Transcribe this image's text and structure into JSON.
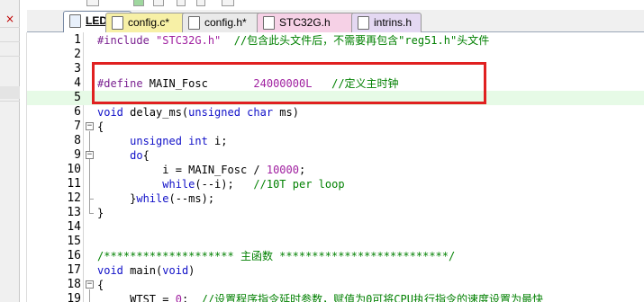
{
  "tabs": [
    {
      "label": "LED.c",
      "active": true,
      "color": "#ffffff"
    },
    {
      "label": "config.c*",
      "active": false,
      "color": "#f7f0a6"
    },
    {
      "label": "config.h*",
      "active": false,
      "color": "#eaeaea"
    },
    {
      "label": "STC32G.h",
      "active": false,
      "color": "#f6d1e6"
    },
    {
      "label": "intrins.h",
      "active": false,
      "color": "#e4d8f2"
    }
  ],
  "sidebar": {
    "close_glyph": "×"
  },
  "editor": {
    "lines": [
      {
        "n": "1",
        "tokens": [
          {
            "t": "#include ",
            "c": "pp"
          },
          {
            "t": "\"STC32G.h\"",
            "c": "str"
          },
          {
            "t": "  //包含此头文件后，不需要再包含\"reg51.h\"头文件",
            "c": "cmt"
          }
        ]
      },
      {
        "n": "2",
        "tokens": []
      },
      {
        "n": "3",
        "tokens": []
      },
      {
        "n": "4",
        "tokens": [
          {
            "t": "#define ",
            "c": "pp"
          },
          {
            "t": "MAIN_Fosc       ",
            "c": ""
          },
          {
            "t": "24000000L",
            "c": "num"
          },
          {
            "t": "   //定义主时钟",
            "c": "cmt"
          }
        ]
      },
      {
        "n": "5",
        "tokens": []
      },
      {
        "n": "6",
        "tokens": [
          {
            "t": "void",
            "c": "kw"
          },
          {
            "t": " delay_ms(",
            "c": ""
          },
          {
            "t": "unsigned char",
            "c": "kw"
          },
          {
            "t": " ms)",
            "c": ""
          }
        ]
      },
      {
        "n": "7",
        "tokens": [
          {
            "t": "{",
            "c": ""
          }
        ]
      },
      {
        "n": "8",
        "tokens": [
          {
            "t": "     ",
            "c": ""
          },
          {
            "t": "unsigned int",
            "c": "kw"
          },
          {
            "t": " i;",
            "c": ""
          }
        ]
      },
      {
        "n": "9",
        "tokens": [
          {
            "t": "     ",
            "c": ""
          },
          {
            "t": "do",
            "c": "kw"
          },
          {
            "t": "{",
            "c": ""
          }
        ]
      },
      {
        "n": "10",
        "tokens": [
          {
            "t": "          i = MAIN_Fosc / ",
            "c": ""
          },
          {
            "t": "10000",
            "c": "num"
          },
          {
            "t": ";",
            "c": ""
          }
        ]
      },
      {
        "n": "11",
        "tokens": [
          {
            "t": "          ",
            "c": ""
          },
          {
            "t": "while",
            "c": "kw"
          },
          {
            "t": "(--i);   ",
            "c": ""
          },
          {
            "t": "//10T per loop",
            "c": "cmt"
          }
        ]
      },
      {
        "n": "12",
        "tokens": [
          {
            "t": "     }",
            "c": ""
          },
          {
            "t": "while",
            "c": "kw"
          },
          {
            "t": "(--ms);",
            "c": ""
          }
        ]
      },
      {
        "n": "13",
        "tokens": [
          {
            "t": "}",
            "c": ""
          }
        ]
      },
      {
        "n": "14",
        "tokens": []
      },
      {
        "n": "15",
        "tokens": []
      },
      {
        "n": "16",
        "tokens": [
          {
            "t": "/******************** 主函数 **************************/",
            "c": "cmt"
          }
        ]
      },
      {
        "n": "17",
        "tokens": [
          {
            "t": "void",
            "c": "kw"
          },
          {
            "t": " main(",
            "c": ""
          },
          {
            "t": "void",
            "c": "kw"
          },
          {
            "t": ")",
            "c": ""
          }
        ]
      },
      {
        "n": "18",
        "tokens": [
          {
            "t": "{",
            "c": ""
          }
        ]
      },
      {
        "n": "19",
        "tokens": [
          {
            "t": "     WTST = ",
            "c": ""
          },
          {
            "t": "0",
            "c": "num"
          },
          {
            "t": ";  ",
            "c": ""
          },
          {
            "t": "//设置程序指令延时参数，赋值为0可将CPU执行指令的速度设置为最快",
            "c": "cmt"
          }
        ]
      }
    ],
    "current_line": "5",
    "debug_arrow_line": "6"
  },
  "colors": {
    "keyword": "#1010c8",
    "comment": "#008000",
    "string": "#a020a0",
    "highlight_box": "#e02020",
    "current_line_bg": "#e6fae6"
  }
}
